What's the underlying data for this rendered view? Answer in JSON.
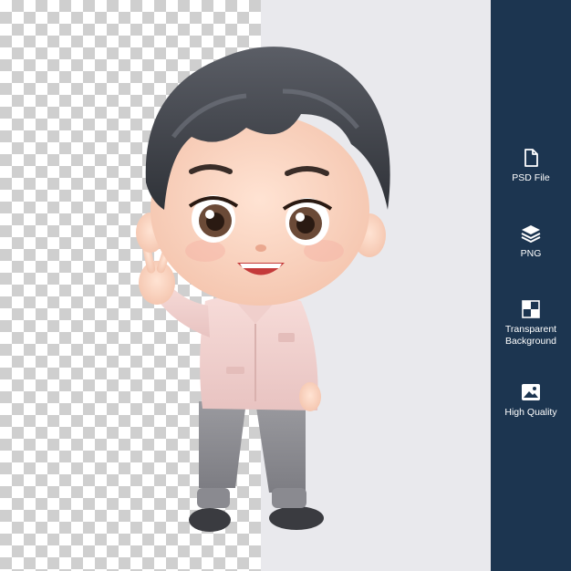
{
  "features": [
    {
      "icon": "file-icon",
      "label": "PSD File"
    },
    {
      "icon": "layers-icon",
      "label": "PNG"
    },
    {
      "icon": "transparency-icon",
      "label": "Transparent Background"
    },
    {
      "icon": "image-icon",
      "label": "High Quality"
    }
  ],
  "colors": {
    "sidebar": "#1c3550",
    "background": "#e9e9ed",
    "checker": "#cfcfcf"
  }
}
